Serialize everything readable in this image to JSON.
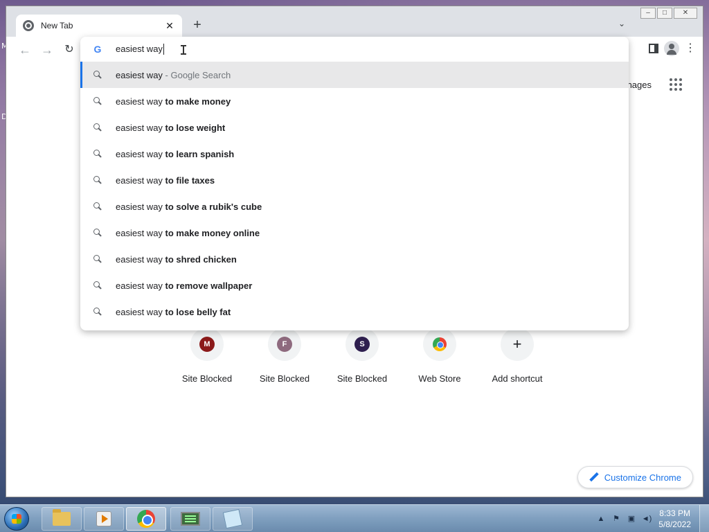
{
  "desktop": {
    "left_labels": [
      "M",
      "D"
    ]
  },
  "window": {
    "minimize": "–",
    "restore": "□",
    "close": "✕"
  },
  "tab": {
    "title": "New Tab",
    "close": "✕",
    "new_tab": "+",
    "tab_search": "⌄"
  },
  "toolbar": {
    "back": "←",
    "forward": "→",
    "reload": "↻",
    "menu": "⋮"
  },
  "omnibox": {
    "text": "easiest way",
    "g_logo": "G"
  },
  "suggestions": [
    {
      "prefix": "easiest way",
      "bold": "",
      "suffix": " - Google Search",
      "selected": true
    },
    {
      "prefix": "easiest way ",
      "bold": "to make money",
      "suffix": "",
      "selected": false
    },
    {
      "prefix": "easiest way ",
      "bold": "to lose weight",
      "suffix": "",
      "selected": false
    },
    {
      "prefix": "easiest way ",
      "bold": "to learn spanish",
      "suffix": "",
      "selected": false
    },
    {
      "prefix": "easiest way ",
      "bold": "to file taxes",
      "suffix": "",
      "selected": false
    },
    {
      "prefix": "easiest way ",
      "bold": "to solve a rubik's cube",
      "suffix": "",
      "selected": false
    },
    {
      "prefix": "easiest way ",
      "bold": "to make money online",
      "suffix": "",
      "selected": false
    },
    {
      "prefix": "easiest way ",
      "bold": "to shred chicken",
      "suffix": "",
      "selected": false
    },
    {
      "prefix": "easiest way ",
      "bold": "to remove wallpaper",
      "suffix": "",
      "selected": false
    },
    {
      "prefix": "easiest way ",
      "bold": "to lose belly fat",
      "suffix": "",
      "selected": false
    }
  ],
  "page": {
    "images_link": "nages",
    "customize_label": "Customize Chrome"
  },
  "shortcuts": [
    {
      "letter": "M",
      "label": "Site Blocked",
      "color": "#8b1a1a",
      "kind": "letter"
    },
    {
      "letter": "F",
      "label": "Site Blocked",
      "color": "#8e6a7e",
      "kind": "letter"
    },
    {
      "letter": "S",
      "label": "Site Blocked",
      "color": "#2e1f4f",
      "kind": "letter"
    },
    {
      "letter": "",
      "label": "Web Store",
      "color": "",
      "kind": "store"
    },
    {
      "letter": "+",
      "label": "Add shortcut",
      "color": "",
      "kind": "add"
    }
  ],
  "taskbar": {
    "time": "8:33 PM",
    "date": "5/8/2022",
    "tray_arrow": "▲"
  }
}
